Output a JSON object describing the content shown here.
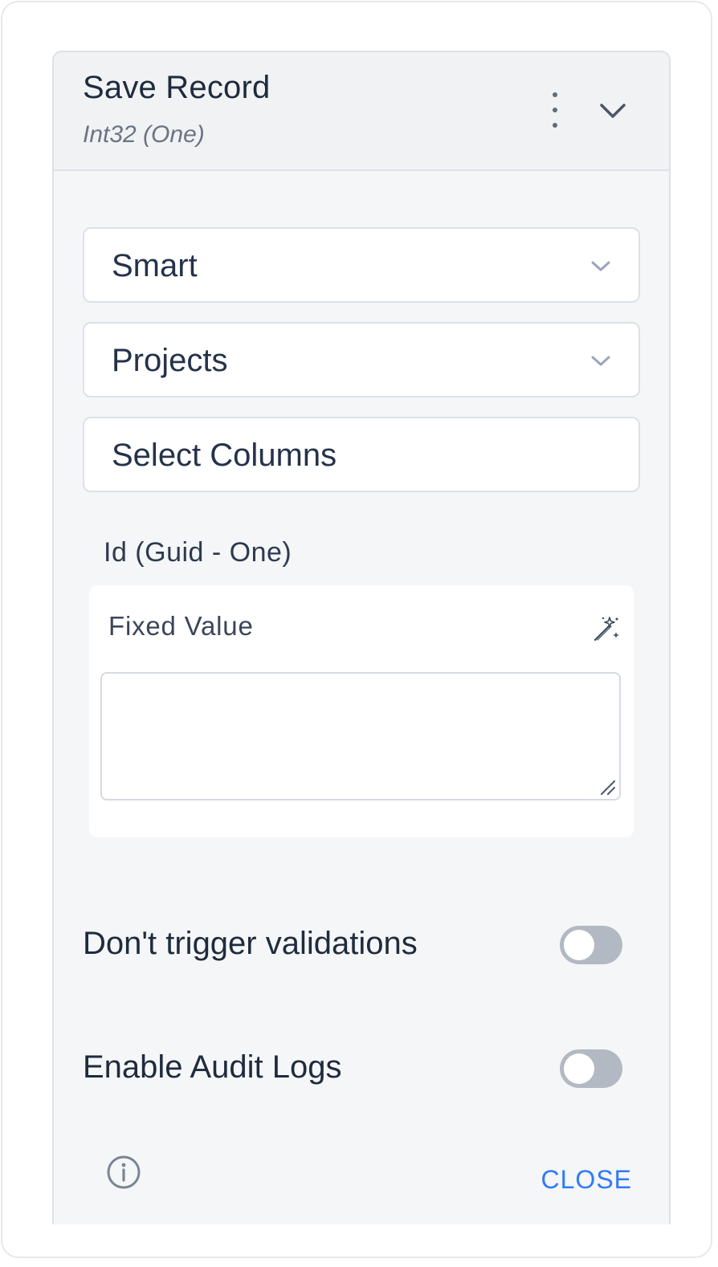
{
  "header": {
    "title": "Save Record",
    "subtitle": "Int32 (One)",
    "more_icon": "vertical-dots-icon",
    "collapse_icon": "chevron-down-icon"
  },
  "selects": {
    "mode": "Smart",
    "table": "Projects",
    "columns": "Select Columns"
  },
  "field": {
    "label": "Id (Guid - One)",
    "source_label": "Fixed Value",
    "value": "",
    "wand_icon": "magic-wand-icon"
  },
  "options": {
    "dont_trigger_validations": {
      "label": "Don't trigger validations",
      "enabled": false
    },
    "enable_audit_logs": {
      "label": "Enable Audit Logs",
      "enabled": false
    }
  },
  "footer": {
    "info_icon": "info-icon",
    "close_label": "CLOSE"
  },
  "colors": {
    "accent": "#2f7bf5",
    "toggle_off": "#b3b9c2",
    "text_primary": "#1f2b3d"
  }
}
